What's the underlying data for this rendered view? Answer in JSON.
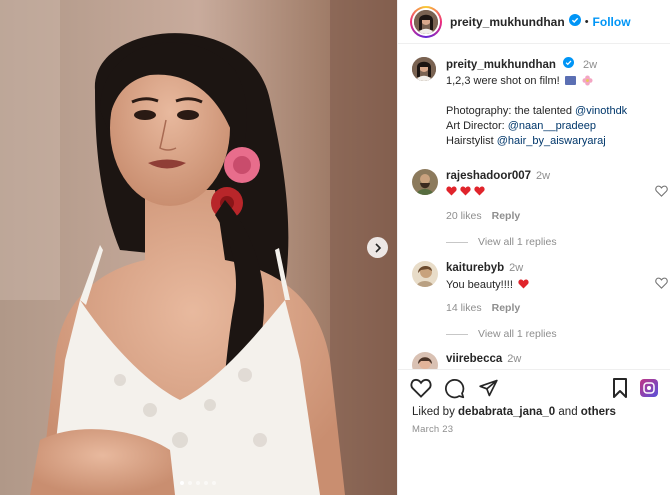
{
  "post": {
    "username": "preity_mukhundhan",
    "follow_label": "Follow",
    "separator": "•",
    "image_alt": "Portrait photo of a woman in a white lace top with roses in her hair",
    "carousel": {
      "slide_count": 5,
      "active_index": 0
    }
  },
  "caption": {
    "username": "preity_mukhundhan",
    "time": "2w",
    "line1": "1,2,3 were shot on film!",
    "line2_prefix": "Photography: the talented ",
    "line2_mention": "@vinothdk",
    "line3_prefix": "Art Director: ",
    "line3_mention": "@naan__pradeep",
    "line4_prefix": "Hairstylist ",
    "line4_mention": "@hair_by_aiswaryaraj"
  },
  "comments": [
    {
      "username": "rajeshadoor007",
      "time": "2w",
      "text": "",
      "likes": "20 likes",
      "reply": "Reply",
      "view_replies": "View all 1 replies",
      "heart_count": 3
    },
    {
      "username": "kaiturebyb",
      "time": "2w",
      "text": "You beauty!!!!",
      "likes": "14 likes",
      "reply": "Reply",
      "view_replies": "View all 1 replies",
      "heart_count": 1
    },
    {
      "username": "viirebecca",
      "time": "2w"
    }
  ],
  "footer": {
    "liked_by_prefix": "Liked by ",
    "liked_by_user": "debabrata_jana_0",
    "liked_by_and": " and ",
    "liked_by_others": "others",
    "date": "March 23"
  },
  "colors": {
    "accent": "#0095f6",
    "verified": "#0095f6",
    "heart": "#ed4956",
    "mention": "#00376b"
  }
}
